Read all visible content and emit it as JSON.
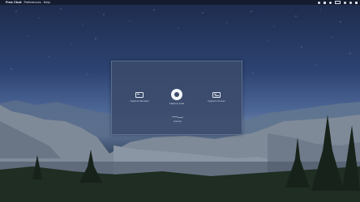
{
  "menubar": {
    "apple_glyph": "",
    "app_name": "Free Chat",
    "items": [
      "Preferences",
      "Help"
    ],
    "status_icons": [
      "wifi-icon",
      "bluetooth-icon",
      "volume-icon",
      "battery-icon",
      "search-icon",
      "siri-icon",
      "control-center-icon"
    ]
  },
  "overlay": {
    "options": [
      {
        "id": "left",
        "label": "Capture Window",
        "icon": "window-icon"
      },
      {
        "id": "center",
        "label": "Capture Area",
        "icon": "aperture-icon"
      },
      {
        "id": "right",
        "label": "Capture Screen",
        "icon": "screen-icon"
      },
      {
        "id": "bottom",
        "label": "Cancel",
        "icon": "stroke-icon"
      }
    ]
  },
  "colors": {
    "sky_top": "#1d2b4c",
    "sky_horizon": "#6a7fa3",
    "panel": "#3a4a6a",
    "icon": "#f1f4f9"
  }
}
